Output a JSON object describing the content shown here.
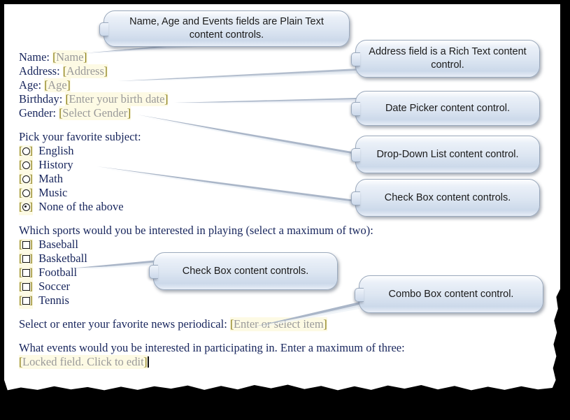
{
  "document": {
    "fields": [
      {
        "label": "Name:",
        "control": "Name",
        "name": "name"
      },
      {
        "label": "Address:",
        "control": "Address",
        "name": "address"
      },
      {
        "label": "Age:",
        "control": "Age",
        "name": "age"
      },
      {
        "label": "Birthday:",
        "control": "Enter your birth date",
        "name": "birthday"
      },
      {
        "label": "Gender:",
        "control": "Select Gender",
        "name": "gender"
      }
    ],
    "subject_prompt": "Pick your favorite subject:",
    "subject_options": [
      {
        "label": "English",
        "selected": false
      },
      {
        "label": "History",
        "selected": false
      },
      {
        "label": "Math",
        "selected": false
      },
      {
        "label": "Music",
        "selected": false
      },
      {
        "label": "None of the above",
        "selected": true
      }
    ],
    "sports_prompt": "Which sports would you be interested in playing (select a maximum of two):",
    "sports_options": [
      {
        "label": "Baseball",
        "checked": false
      },
      {
        "label": "Basketball",
        "checked": false
      },
      {
        "label": "Football",
        "checked": false
      },
      {
        "label": "Soccer",
        "checked": false
      },
      {
        "label": "Tennis",
        "checked": false
      }
    ],
    "periodical_prompt": "Select or enter your favorite news periodical:",
    "periodical_control": "Enter or select item",
    "events_prompt": "What events would you be interested in participating in. Enter a maximum of three:",
    "events_control": "Locked field. Click to edit"
  },
  "callouts": [
    {
      "id": "plain-text",
      "text": "Name, Age and Events fields are Plain Text content controls."
    },
    {
      "id": "rich-text",
      "text": "Address field is a Rich Text content control."
    },
    {
      "id": "date-picker",
      "text": "Date Picker content control."
    },
    {
      "id": "drop-down",
      "text": "Drop-Down List content control."
    },
    {
      "id": "check-box-1",
      "text": "Check Box content controls."
    },
    {
      "id": "check-box-2",
      "text": "Check Box content controls."
    },
    {
      "id": "combo-box",
      "text": "Combo Box content control."
    }
  ],
  "colors": {
    "page_background": "#ffffff",
    "frame": "#000000",
    "text": "#17255c",
    "control_highlight": "#fdfae4",
    "control_bracket": "#8a7d15",
    "placeholder_text": "#9a9a9a",
    "callout_fill": "#dde6f2",
    "callout_border": "#9aa9bd"
  }
}
